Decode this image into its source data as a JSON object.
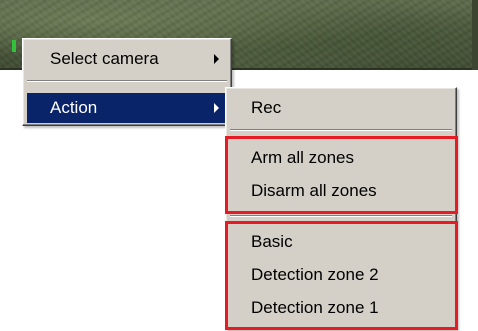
{
  "context_menu": {
    "items": [
      {
        "label": "Select camera",
        "has_submenu": true,
        "selected": false
      },
      {
        "label": "Action",
        "has_submenu": true,
        "selected": true
      }
    ]
  },
  "action_submenu": {
    "items": [
      {
        "label": "Rec"
      },
      {
        "label": "Arm all zones"
      },
      {
        "label": "Disarm all zones"
      },
      {
        "label": "Basic"
      },
      {
        "label": "Detection zone 2"
      },
      {
        "label": "Detection zone 1"
      }
    ]
  },
  "colors": {
    "menu_background": "#d4d0c8",
    "selected_background": "#0a246a",
    "highlight_border": "#e51c23",
    "camera_marker": "#31c23a"
  },
  "icons": {
    "submenu_arrow": "chevron-right-icon"
  }
}
